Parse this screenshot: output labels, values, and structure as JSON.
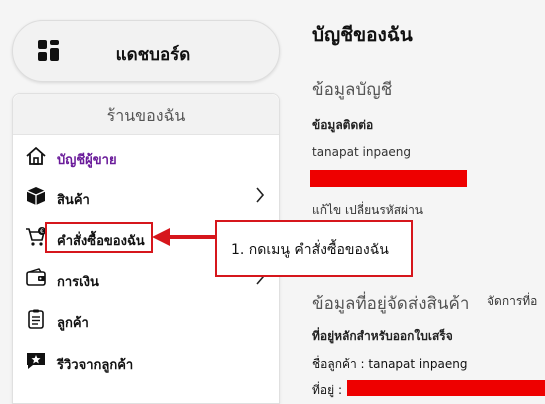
{
  "dashboard": {
    "label": "แดชบอร์ด",
    "icon": "dashboard-grid-icon"
  },
  "sidebar": {
    "title": "ร้านของฉัน",
    "items": [
      {
        "label": "บัญชีผู้ขาย",
        "icon": "home-icon",
        "active": true,
        "has_chevron": false
      },
      {
        "label": "สินค้า",
        "icon": "box-icon",
        "active": false,
        "has_chevron": true
      },
      {
        "label": "คำสั่งซื้อของฉัน",
        "icon": "cart-icon",
        "active": false,
        "has_chevron": false
      },
      {
        "label": "การเงิน",
        "icon": "wallet-icon",
        "active": false,
        "has_chevron": true
      },
      {
        "label": "ลูกค้า",
        "icon": "clipboard-icon",
        "active": false,
        "has_chevron": false
      },
      {
        "label": "รีวิวจากลูกค้า",
        "icon": "review-star-icon",
        "active": false,
        "has_chevron": false
      }
    ]
  },
  "callout": {
    "text": "1. กดเมนู คำสั่งซื้อของฉัน"
  },
  "main": {
    "title": "บัญชีของฉัน",
    "account_section": "ข้อมูลบัญชี",
    "contact_heading": "ข้อมูลติดต่อ",
    "contact_name": "tanapat inpaeng",
    "edit_link": "แก้ไข เปลี่ยนรหัสผ่าน",
    "shipping_section": "ข้อมูลที่อยู่จัดส่งสินค้า",
    "manage_link": "จัดการที่อ",
    "billing_heading": "ที่อยู่หลักสำหรับออกใบเสร็จ",
    "customer_name_line": "ชื่อลูกค้า : tanapat inpaeng",
    "address_label": "ที่อยู่ :"
  },
  "colors": {
    "accent_purple": "#6a1b9a",
    "annotation_red": "#d6161c",
    "redaction_red": "#ee0000"
  }
}
